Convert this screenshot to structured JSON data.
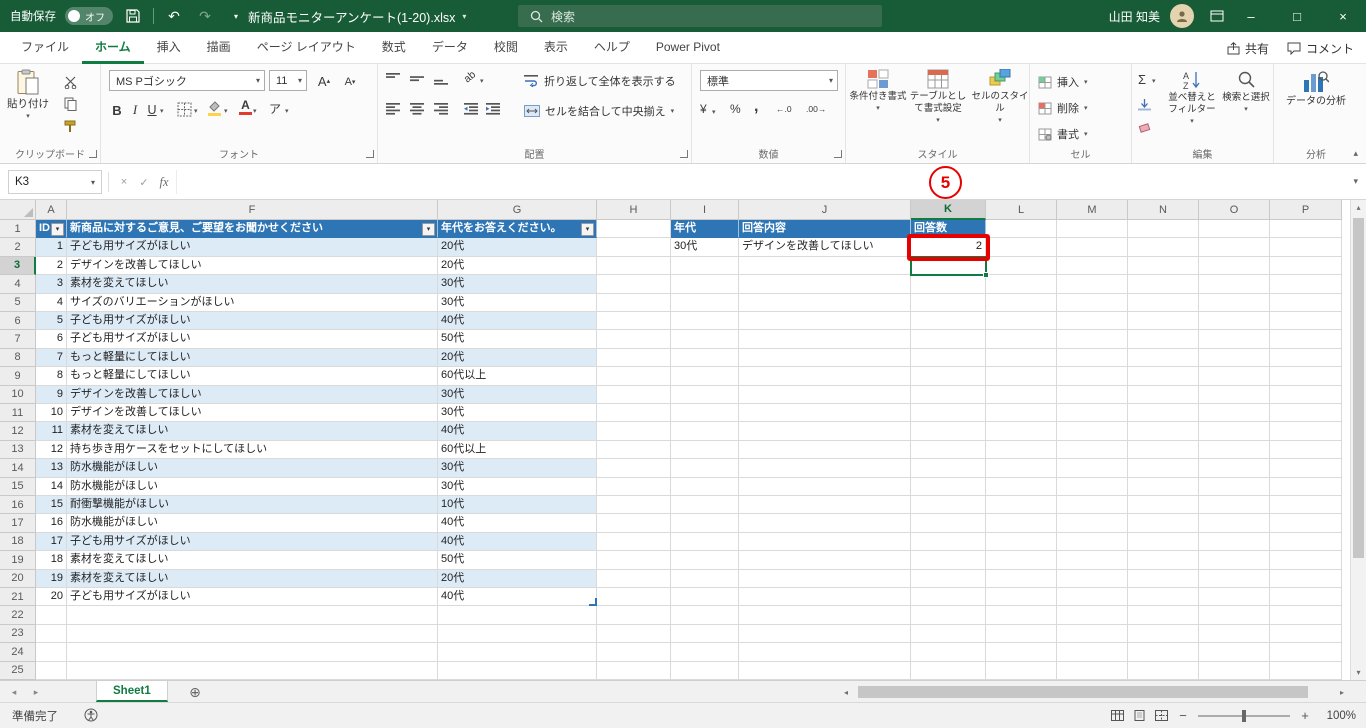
{
  "colors": {
    "titlebar_green": "#185C37",
    "accent_green": "#107C41",
    "table_header_blue": "#2E75B6",
    "band_blue": "#DDEBF7",
    "annotation_red": "#E60000"
  },
  "icons": {
    "dropdown": "▾",
    "chevron_up": "▴",
    "undo": "↶",
    "redo": "↷",
    "minimize": "–",
    "maximize": "□",
    "close": "×",
    "scroll_up": "▴",
    "scroll_down": "▾",
    "scroll_left": "◂",
    "scroll_right": "▸",
    "add_sheet": "⊕",
    "autosum": "Σ",
    "percent": "%",
    "comma": ",",
    "currency": "¥",
    "inc_decimal": "←.0",
    "dec_decimal": ".00→",
    "bold": "B",
    "italic": "I",
    "underline": "U",
    "phonetic": "ア",
    "cancel": "×",
    "enter": "✓",
    "orientation": "ab",
    "increase_font": "A",
    "decrease_font": "A",
    "sort_az": "AZ↓"
  },
  "titlebar": {
    "autosave_label": "自動保存",
    "autosave_state": "オフ",
    "filename": "新商品モニターアンケート(1-20).xlsx",
    "search_placeholder": "検索",
    "user_name": "山田 知美"
  },
  "ribbon": {
    "tabs": [
      "ファイル",
      "ホーム",
      "挿入",
      "描画",
      "ページ レイアウト",
      "数式",
      "データ",
      "校閲",
      "表示",
      "ヘルプ",
      "Power Pivot"
    ],
    "active_tab": "ホーム",
    "share": "共有",
    "comments": "コメント",
    "clipboard": {
      "group": "クリップボード",
      "paste": "貼り付け"
    },
    "font": {
      "group": "フォント",
      "name": "MS Pゴシック",
      "size": "11"
    },
    "alignment": {
      "group": "配置",
      "wrap": "折り返して全体を表示する",
      "merge": "セルを結合して中央揃え"
    },
    "number": {
      "group": "数値",
      "format": "標準"
    },
    "styles": {
      "group": "スタイル",
      "conditional": "条件付き書式",
      "format_table": "テーブルとして書式設定",
      "cell_styles": "セルのスタイル"
    },
    "cells": {
      "group": "セル",
      "insert": "挿入",
      "delete": "削除",
      "format": "書式"
    },
    "editing": {
      "group": "編集",
      "sort_filter": "並べ替えとフィルター",
      "find_select": "検索と選択"
    },
    "analysis": {
      "group": "分析",
      "data_analysis": "データの分析"
    }
  },
  "formula_bar": {
    "name_box": "K3",
    "fx": "fx",
    "formula": ""
  },
  "annotation": {
    "step": "5"
  },
  "sheet": {
    "columns": [
      "A",
      "F",
      "G",
      "H",
      "I",
      "J",
      "K",
      "L",
      "M",
      "N",
      "O",
      "P"
    ],
    "selected_cell": "K3",
    "table": {
      "headers": [
        "ID",
        "新商品に対するご意見、ご要望をお聞かせください",
        "年代をお答えください。"
      ],
      "rows": [
        [
          "1",
          "子ども用サイズがほしい",
          "20代"
        ],
        [
          "2",
          "デザインを改善してほしい",
          "20代"
        ],
        [
          "3",
          "素材を変えてほしい",
          "30代"
        ],
        [
          "4",
          "サイズのバリエーションがほしい",
          "30代"
        ],
        [
          "5",
          "子ども用サイズがほしい",
          "40代"
        ],
        [
          "6",
          "子ども用サイズがほしい",
          "50代"
        ],
        [
          "7",
          "もっと軽量にしてほしい",
          "20代"
        ],
        [
          "8",
          "もっと軽量にしてほしい",
          "60代以上"
        ],
        [
          "9",
          "デザインを改善してほしい",
          "30代"
        ],
        [
          "10",
          "デザインを改善してほしい",
          "30代"
        ],
        [
          "11",
          "素材を変えてほしい",
          "40代"
        ],
        [
          "12",
          "持ち歩き用ケースをセットにしてほしい",
          "60代以上"
        ],
        [
          "13",
          "防水機能がほしい",
          "30代"
        ],
        [
          "14",
          "防水機能がほしい",
          "30代"
        ],
        [
          "15",
          "耐衝撃機能がほしい",
          "10代"
        ],
        [
          "16",
          "防水機能がほしい",
          "40代"
        ],
        [
          "17",
          "子ども用サイズがほしい",
          "40代"
        ],
        [
          "18",
          "素材を変えてほしい",
          "50代"
        ],
        [
          "19",
          "素材を変えてほしい",
          "20代"
        ],
        [
          "20",
          "子ども用サイズがほしい",
          "40代"
        ]
      ]
    },
    "summary": {
      "headers": [
        "年代",
        "回答内容",
        "回答数"
      ],
      "values": [
        "30代",
        "デザインを改善してほしい",
        "2"
      ]
    }
  },
  "sheet_tabs": {
    "active": "Sheet1"
  },
  "status_bar": {
    "mode": "準備完了",
    "zoom": "100%"
  }
}
